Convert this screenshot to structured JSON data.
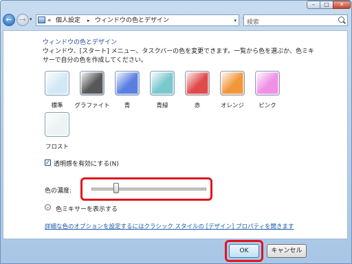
{
  "titlebar": {
    "min_icon": "minimize-icon",
    "max_icon": "maximize-icon",
    "close_icon": "close-icon",
    "min_glyph": "–",
    "max_glyph": "□",
    "close_glyph": "✕"
  },
  "nav": {
    "back_glyph": "←",
    "forward_glyph": "→",
    "dropdown_glyph": "▾",
    "breadcrumb": [
      "«",
      "個人設定",
      "▸",
      "ウィンドウの色とデザイン"
    ],
    "refresh_glyph": "↻"
  },
  "search": {
    "placeholder": "検索"
  },
  "main": {
    "heading": "ウィンドウの色とデザイン",
    "description": "ウィンドウ、[スタート] メニュー、タスクバーの色を変更できます。一覧から色を選ぶか、色ミキサーで自分の色を作成してください。",
    "swatches": [
      {
        "label": "標準",
        "color": "#d3e8f5"
      },
      {
        "label": "グラファイト",
        "color": "#585858"
      },
      {
        "label": "青",
        "color": "#5a7fe0"
      },
      {
        "label": "青緑",
        "color": "#79c8cc"
      },
      {
        "label": "赤",
        "color": "#e04a4a"
      },
      {
        "label": "オレンジ",
        "color": "#f2963a"
      },
      {
        "label": "ピンク",
        "color": "#ef90e6"
      },
      {
        "label": "フロスト",
        "color": "#ebf3f3"
      }
    ],
    "transparency_checked": "✓",
    "transparency_label": "透明感を有効にする(N)",
    "intensity_label": "色の濃度:",
    "intensity_value": 0.22,
    "mixer_glyph": "⌄",
    "mixer_label": "色ミキサーを表示する",
    "advanced_link": "詳細な色のオプションを設定するにはクラシック スタイルの [デザイン] プロパティを開きます"
  },
  "footer": {
    "ok_label": "OK",
    "cancel_label": "キャンセル"
  },
  "colors": {
    "highlight": "#e0141c",
    "link": "#1a5aa8"
  }
}
